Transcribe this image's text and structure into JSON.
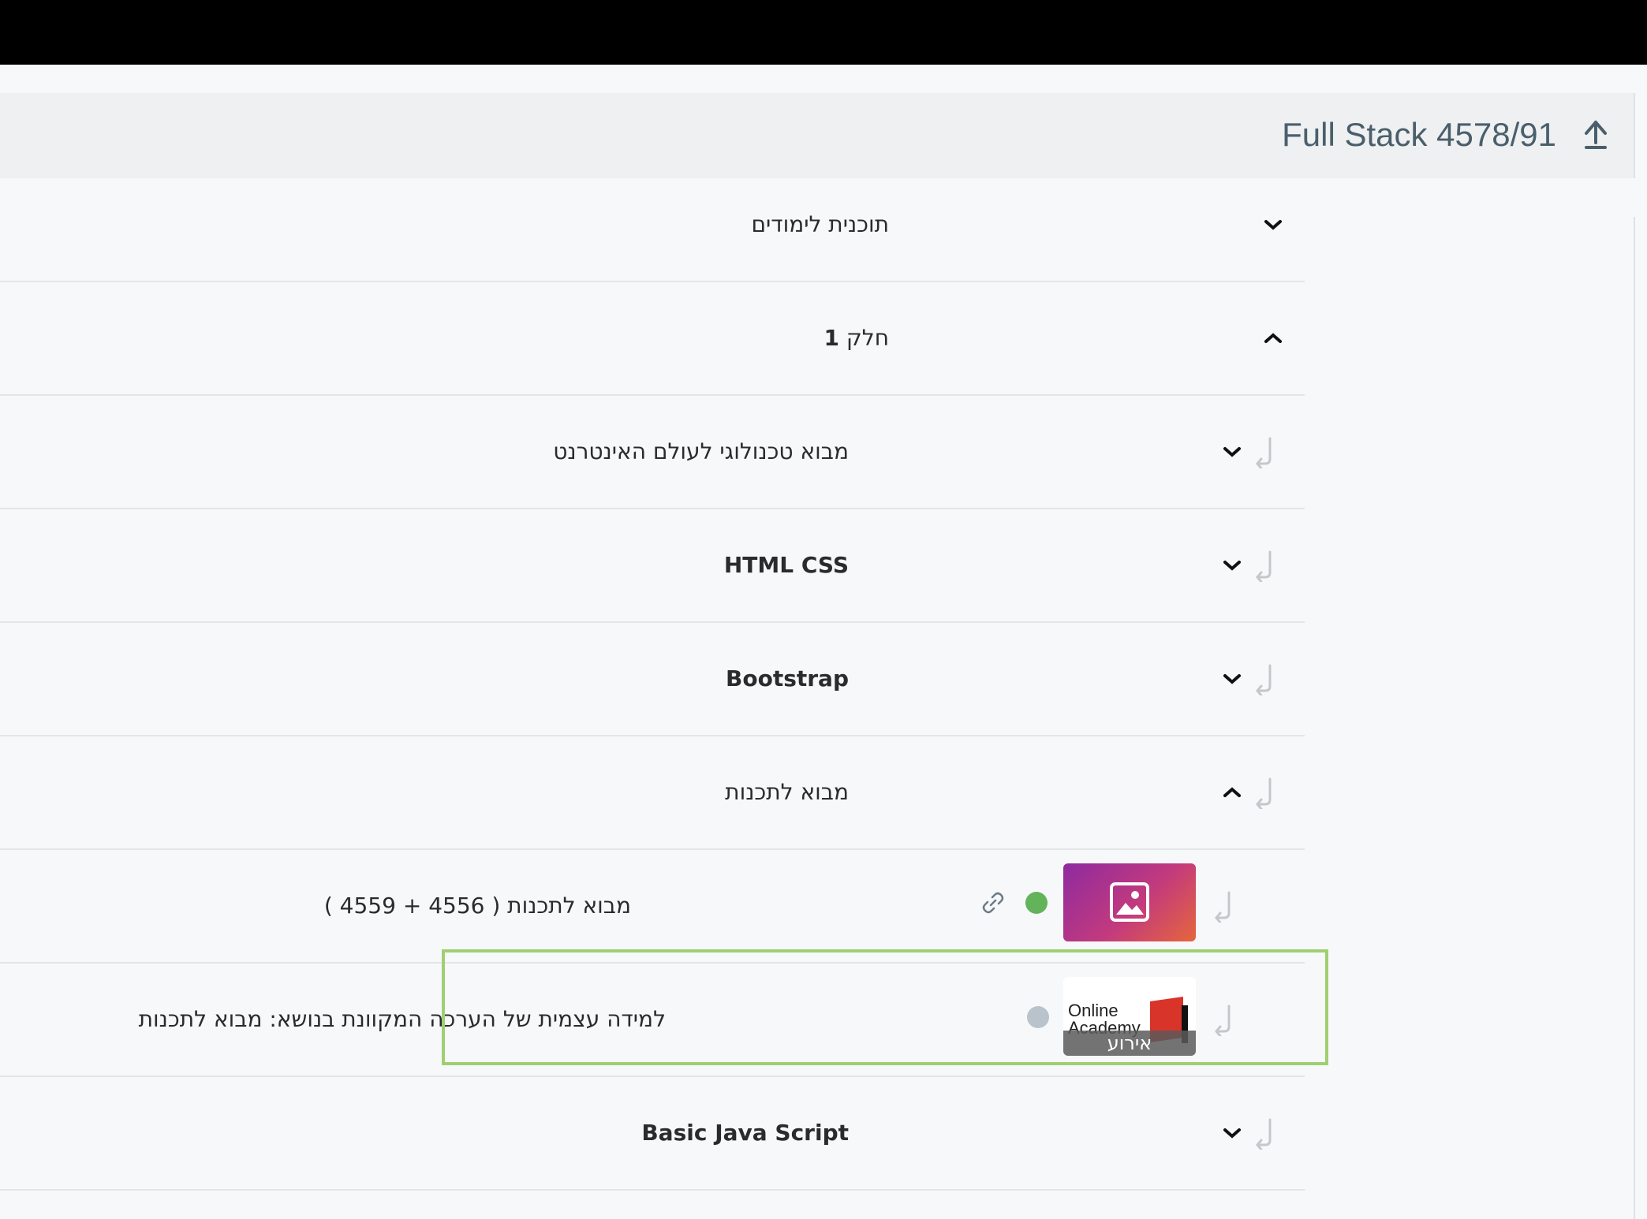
{
  "course": {
    "title": "Full Stack 4578/91",
    "upload_icon": "arrow-up-icon"
  },
  "tree": {
    "program": {
      "label": "תוכנית לימודים",
      "state": "collapsed"
    },
    "part": {
      "label": "חלק",
      "number": "1",
      "state": "expanded"
    },
    "modules": [
      {
        "label": "מבוא טכנולוגי לעולם האינטרנט",
        "state": "collapsed"
      },
      {
        "label": "HTML CSS",
        "state": "collapsed"
      },
      {
        "label": "Bootstrap",
        "state": "collapsed"
      },
      {
        "label": "מבוא לתכנות",
        "state": "expanded"
      },
      {
        "label": "Basic Java Script",
        "state": "collapsed"
      }
    ],
    "items": [
      {
        "label": "מבוא לתכנות ( 4556 + 4559 )",
        "status_color": "#62b35a",
        "icon": "link-icon",
        "thumbnail": "image-placeholder-icon"
      },
      {
        "label": "למידה עצמית של הערכה המקוונת בנושא: מבוא לתכנות",
        "status_color": "#b9c3cc",
        "thumbnail_text_1": "Online",
        "thumbnail_text_2": "Academy",
        "badge": "אירוע",
        "highlight_color": "#9ed073"
      }
    ]
  },
  "colors": {
    "title": "#4a5f6b",
    "header_bg": "#eef0f1",
    "page_bg": "#f7f8f9"
  }
}
